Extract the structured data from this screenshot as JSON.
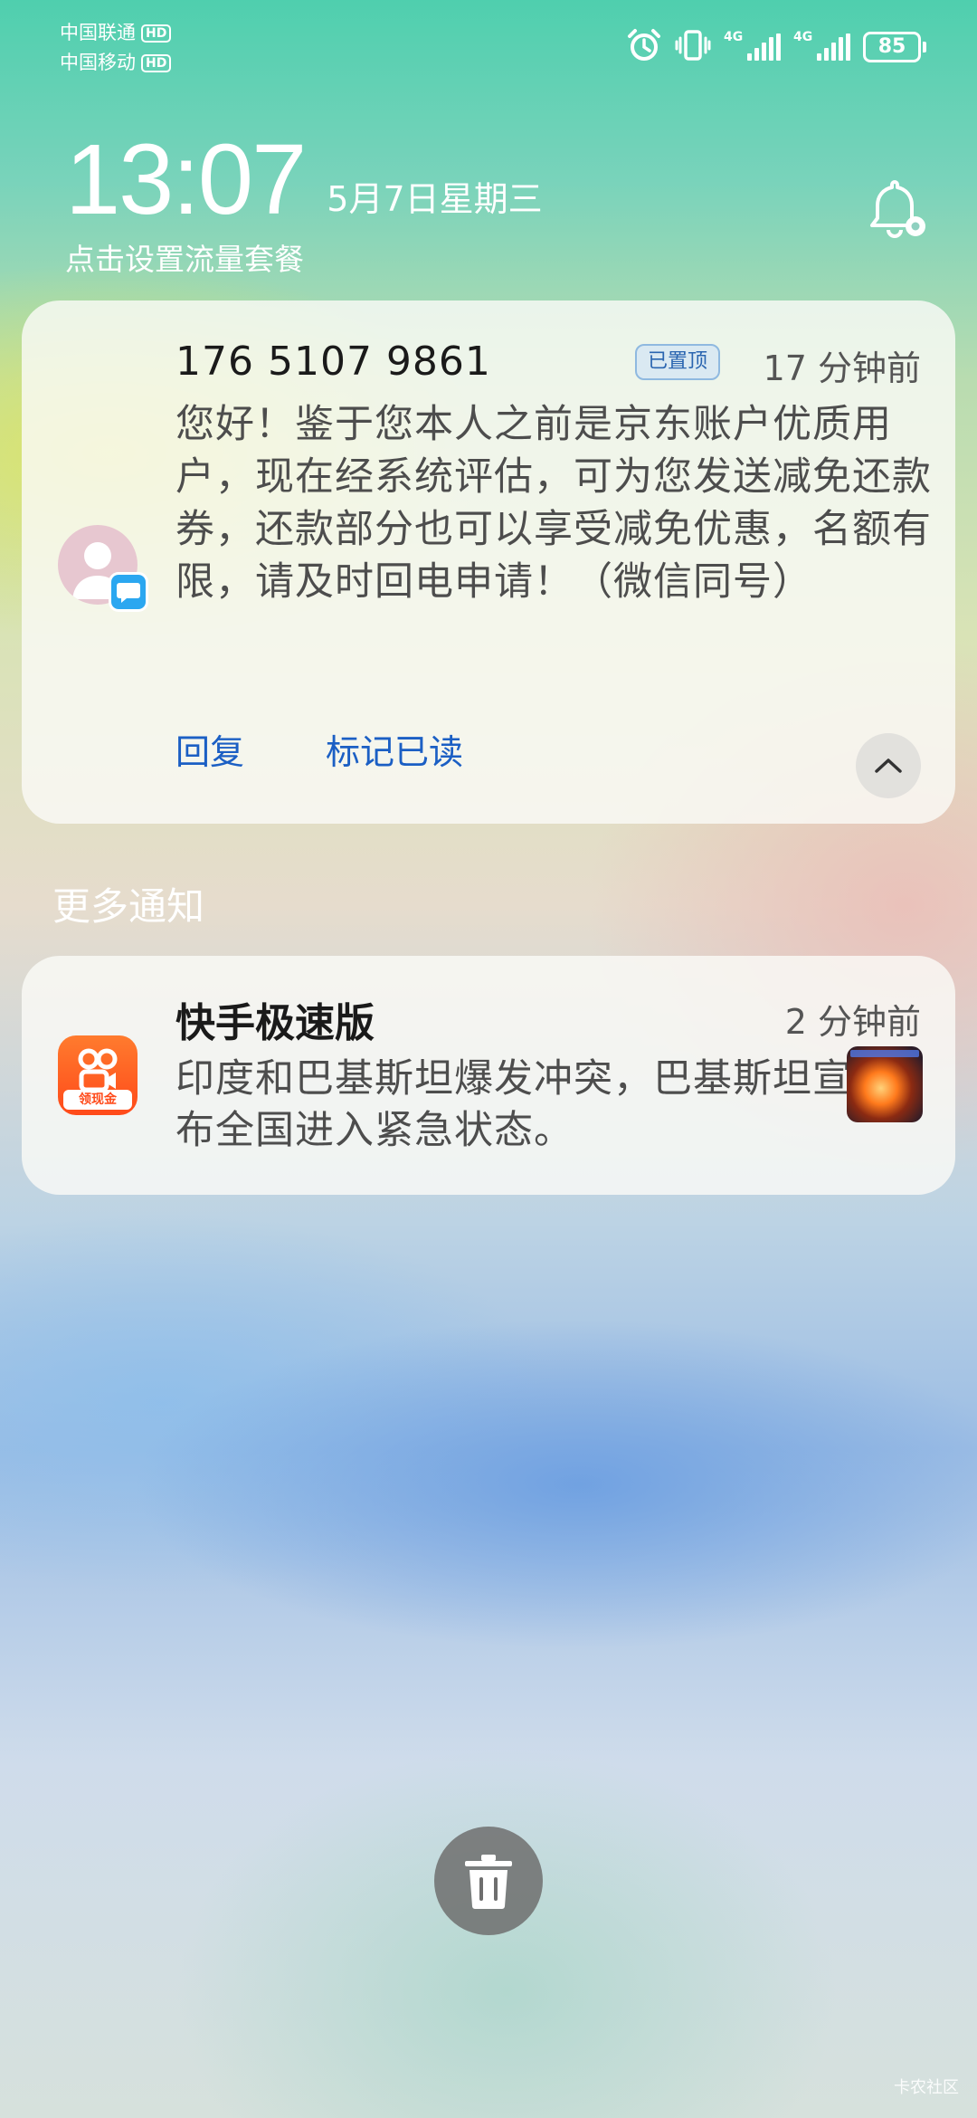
{
  "status_bar": {
    "carriers": [
      {
        "name": "中国联通",
        "badge": "HD"
      },
      {
        "name": "中国移动",
        "badge": "HD"
      }
    ],
    "signal_labels": [
      "4G",
      "4G"
    ],
    "battery": "85",
    "icons": [
      "alarm-icon",
      "vibrate-icon",
      "signal-icon",
      "signal-icon",
      "battery-icon"
    ]
  },
  "lockscreen": {
    "time": "13:07",
    "date": "5月7日星期三",
    "data_plan": "点击设置流量套餐"
  },
  "sms_notification": {
    "sender": "176 5107 9861",
    "pinned": "已置顶",
    "time": "17 分钟前",
    "body": "您好！鉴于您本人之前是京东账户优质用户，现在经系统评估，可为您发送减免还款券，还款部分也可以享受减免优惠，名额有限，请及时回电申请！（微信同号）",
    "actions": {
      "reply": "回复",
      "mark_read": "标记已读"
    }
  },
  "more_notifications": {
    "title": "更多通知"
  },
  "app_notification": {
    "app_name": "快手极速版",
    "icon_tag": "领现金",
    "time": "2 分钟前",
    "body": "印度和巴基斯坦爆发冲突，巴基斯坦宣布全国进入紧急状态。"
  },
  "watermark": "卡农社区",
  "colors": {
    "action_blue": "#1b5fc4",
    "pinned_badge": "#2a65b0",
    "message_badge": "#2ba7f0",
    "app_icon": "#ff4a1a"
  }
}
